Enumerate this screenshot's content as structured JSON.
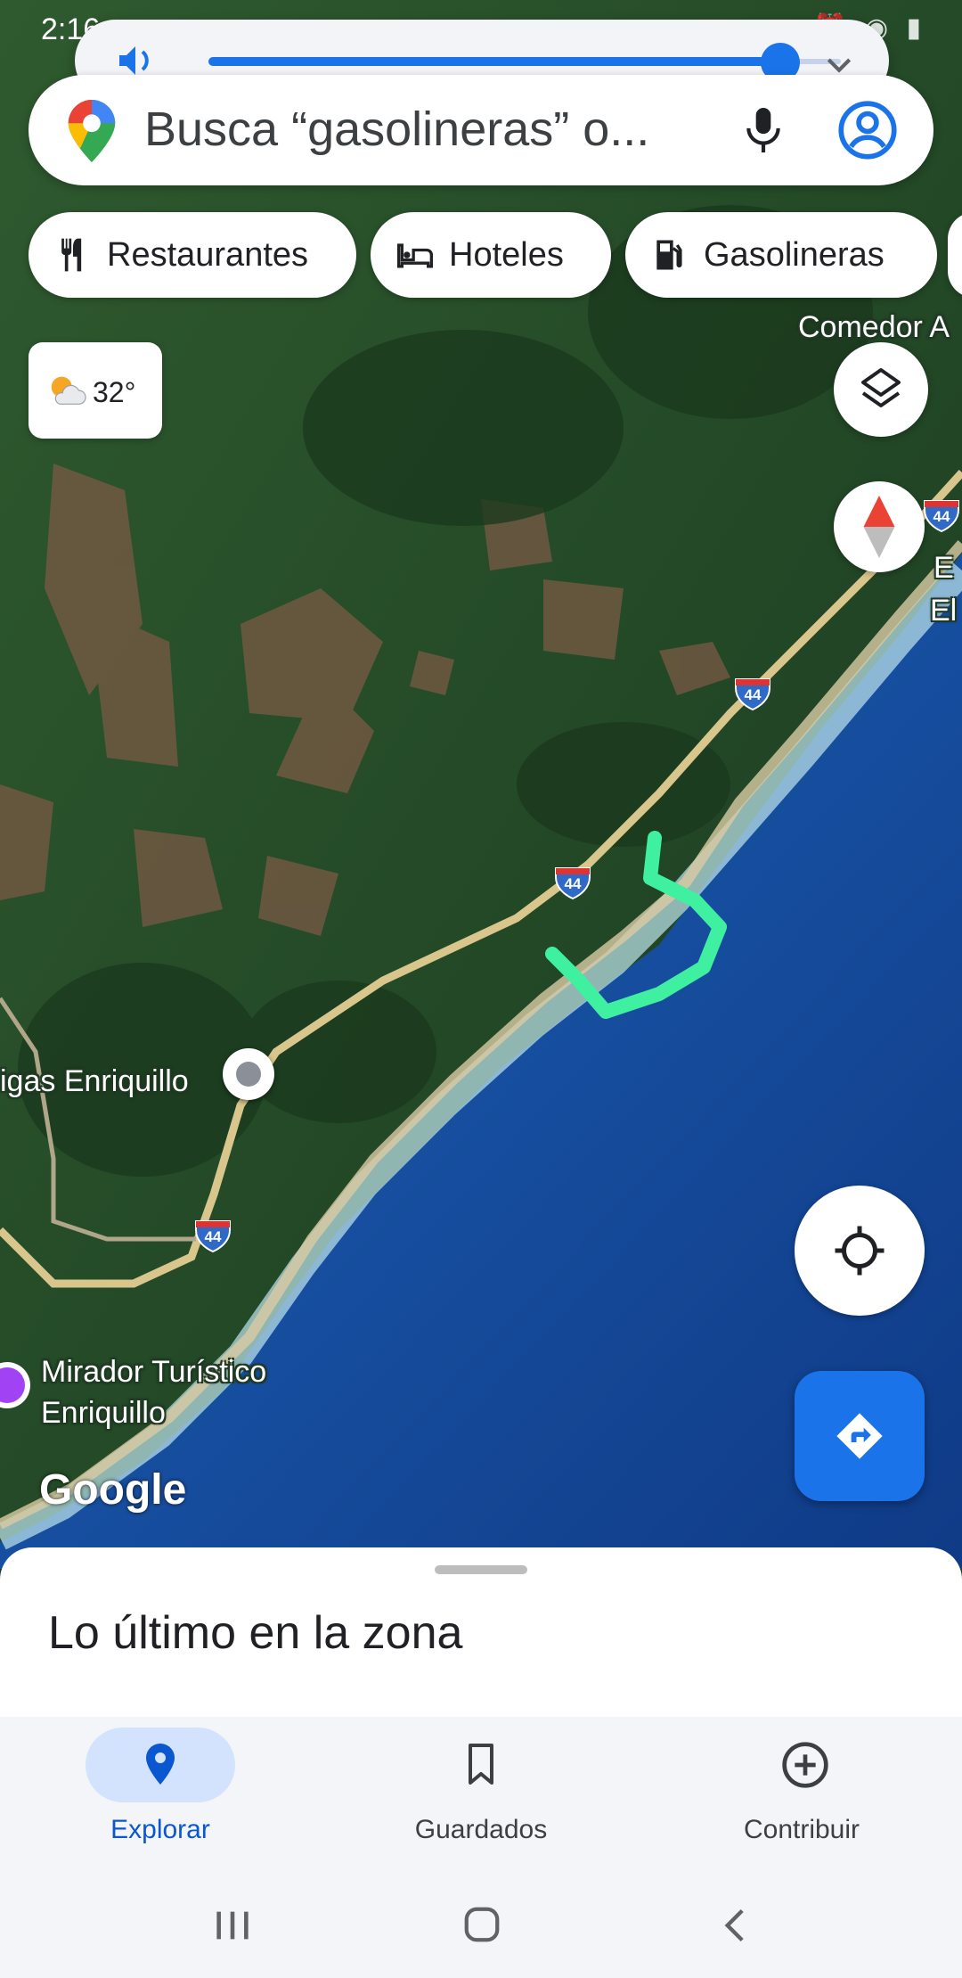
{
  "status_bar": {
    "time": "2:16"
  },
  "search": {
    "placeholder": "Busca “gasolineras” o..."
  },
  "chips": [
    {
      "label": "Restaurantes",
      "icon": "restaurant-icon"
    },
    {
      "label": "Hoteles",
      "icon": "hotel-icon"
    },
    {
      "label": "Gasolineras",
      "icon": "gas-station-icon"
    }
  ],
  "weather": {
    "temperature": "32°",
    "icon": "partly-cloudy-icon"
  },
  "map": {
    "labels": {
      "comedor": "Comedor A",
      "place_left": "igas Enriquillo",
      "mirador_line1": "Mirador Turístico",
      "mirador_line2": "Enriquillo",
      "edge_text_1": "E",
      "edge_text_2": "El"
    },
    "route_shield": "44",
    "attribution": "Google"
  },
  "sheet": {
    "title": "Lo último en la zona"
  },
  "bottom_nav": [
    {
      "label": "Explorar",
      "icon": "explore-pin-icon",
      "active": true
    },
    {
      "label": "Guardados",
      "icon": "bookmark-icon",
      "active": false
    },
    {
      "label": "Contribuir",
      "icon": "add-circle-icon",
      "active": false
    }
  ],
  "colors": {
    "accent": "#1a73e8",
    "annotation": "#3ef0a0",
    "ocean_deep": "#123f8c",
    "vegetation": "#2b4f2c"
  }
}
